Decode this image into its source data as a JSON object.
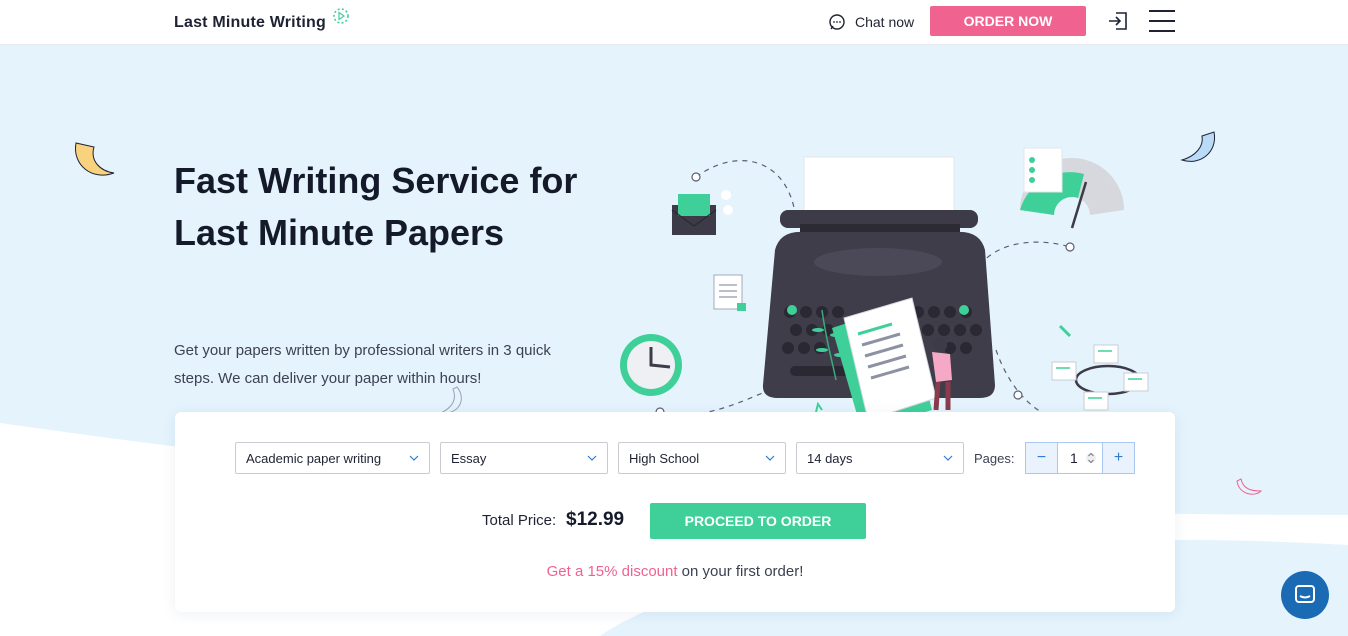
{
  "header": {
    "logo_text": "Last Minute Writing",
    "logo_icon": "spinner-logo-icon",
    "chat_label": "Chat now",
    "chat_icon": "chat-bubble-icon",
    "order_now_label": "ORDER NOW",
    "login_icon": "login-icon",
    "menu_icon": "hamburger-menu-icon"
  },
  "hero": {
    "headline": "Fast Writing Service for Last Minute Papers",
    "subtitle": "Get your papers written by professional writers in 3 quick steps. We can deliver your paper within hours!",
    "illustration": "typewriter-illustration"
  },
  "order_form": {
    "service": "Academic paper writing",
    "paper_type": "Essay",
    "academic_level": "High School",
    "deadline": "14 days",
    "pages_label": "Pages:",
    "pages_value": "1",
    "decrement": "−",
    "increment": "+",
    "total_label": "Total Price:",
    "total_value": "$12.99",
    "proceed_label": "PROCEED TO ORDER",
    "promo_link": "Get a 15% discount",
    "promo_rest": " on your first order!"
  },
  "colors": {
    "accent_pink": "#f0628f",
    "accent_green": "#3fd09a",
    "hero_bg": "#e4f3fc",
    "chat_widget": "#1a6bb3"
  }
}
